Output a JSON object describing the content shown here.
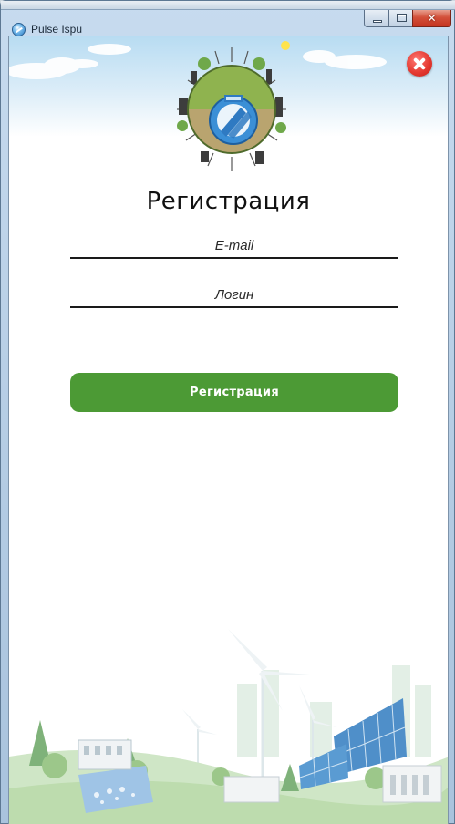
{
  "window": {
    "title": "Pulse Ispu",
    "minimize_icon": "minimize-icon",
    "maximize_icon": "maximize-icon",
    "close_icon": "close-icon",
    "close_glyph": "✕"
  },
  "form": {
    "heading": "Регистрация",
    "email_placeholder": "E-mail",
    "login_placeholder": "Логин",
    "submit_label": "Регистрация",
    "close_icon": "red-circle-close-icon"
  },
  "colors": {
    "accent_green": "#4c9a35",
    "close_red": "#e53a32",
    "window_frame": "#b3cbe3"
  }
}
